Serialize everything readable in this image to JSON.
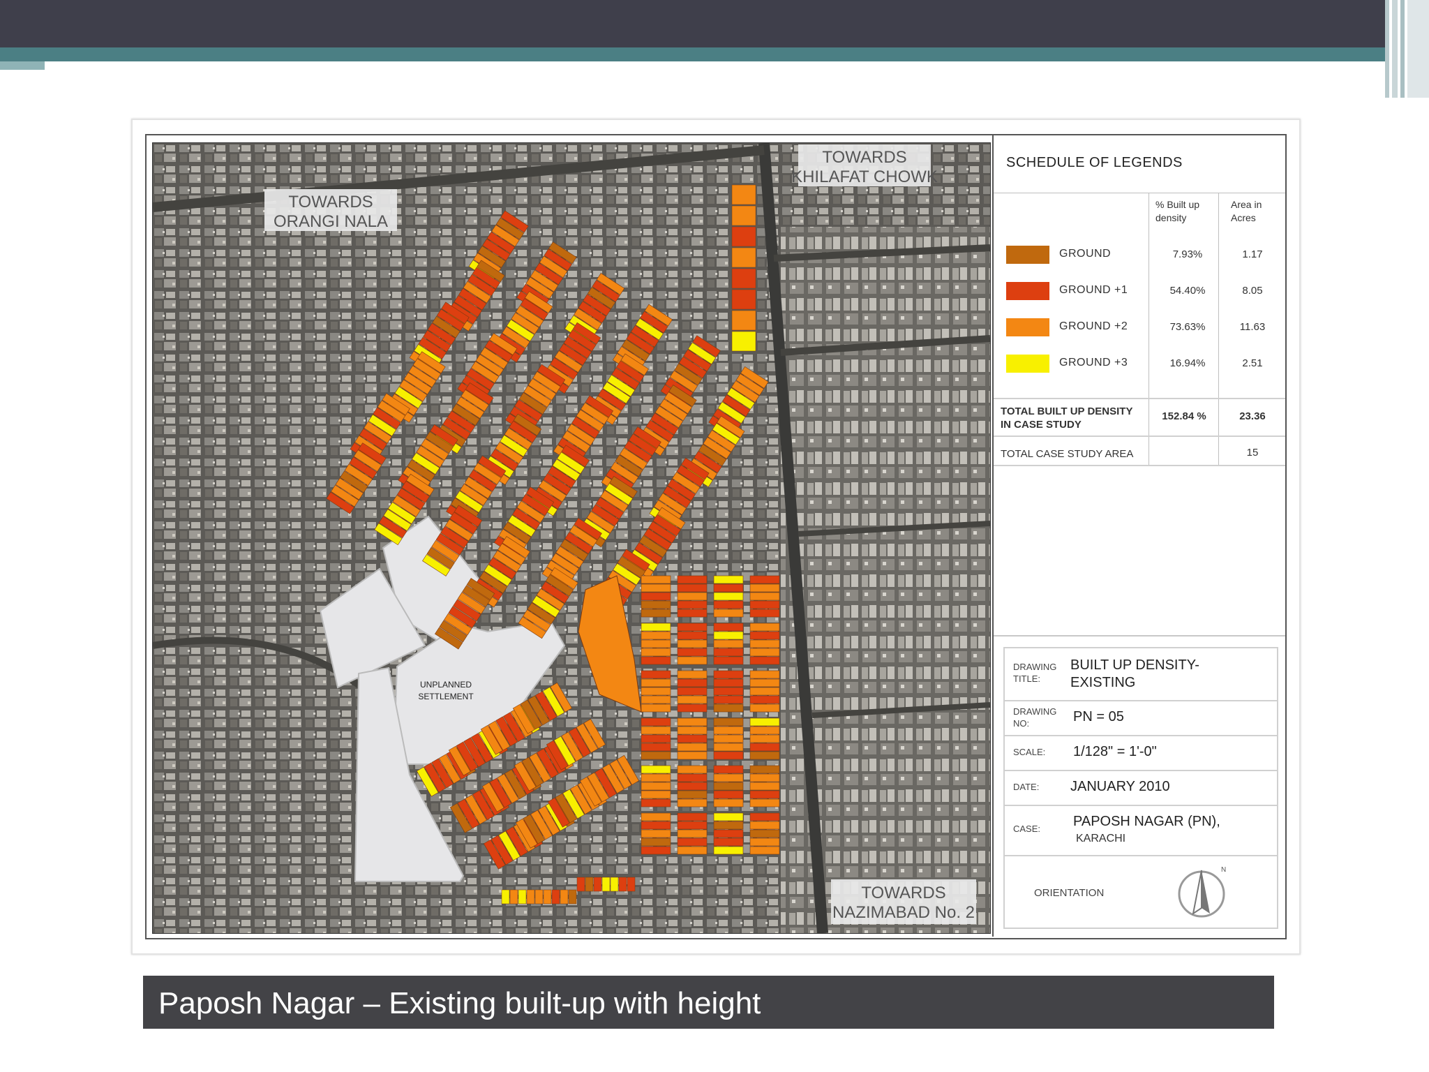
{
  "slide": {
    "caption": "Paposh Nagar – Existing built-up with height"
  },
  "map": {
    "labels": {
      "orangi_line1": "TOWARDS",
      "orangi_line2": "ORANGI NALA",
      "khilafat_line1": "TOWARDS",
      "khilafat_line2": "KHILAFAT CHOWK",
      "nazimabad_line1": "TOWARDS",
      "nazimabad_line2": "NAZIMABAD No. 2",
      "unplanned_line1": "UNPLANNED",
      "unplanned_line2": "SETTLEMENT"
    },
    "colors": {
      "ground": "#c0690e",
      "ground_plus_1": "#dd3f10",
      "ground_plus_2": "#f38713",
      "ground_plus_3": "#f8f000",
      "unplanned": "#e6e6e8",
      "road": "#3a3a38"
    }
  },
  "legend": {
    "title": "SCHEDULE OF LEGENDS",
    "col_density_line1": "% Built up",
    "col_density_line2": "density",
    "col_area_line1": "Area in",
    "col_area_line2": "Acres",
    "rows": [
      {
        "label": "GROUND",
        "density": "7.93%",
        "area": "1.17",
        "color": "#c0690e"
      },
      {
        "label": "GROUND  +1",
        "density": "54.40%",
        "area": "8.05",
        "color": "#dd3f10"
      },
      {
        "label": "GROUND  +2",
        "density": "73.63%",
        "area": "11.63",
        "color": "#f38713"
      },
      {
        "label": "GROUND  +3",
        "density": "16.94%",
        "area": "2.51",
        "color": "#f8f000"
      }
    ],
    "total_label_line1": "TOTAL BUILT UP DENSITY",
    "total_label_line2": "IN CASE STUDY",
    "total_density": "152.84 %",
    "total_area": "23.36",
    "case_area_label": "TOTAL CASE STUDY AREA",
    "case_area_value": "15"
  },
  "title_block": {
    "title_key_line1": "DRAWING",
    "title_key_line2": "TITLE:",
    "title_line1": "BUILT UP DENSITY-",
    "title_line2": "EXISTING",
    "no_key_line1": "DRAWING",
    "no_key_line2": "NO:",
    "drawing_no": "PN = 05",
    "scale_key": "SCALE:",
    "scale": "1/128\" = 1'-0\"",
    "date_key": "DATE:",
    "date": "JANUARY 2010",
    "case_key": "CASE:",
    "case_line1": "PAPOSH NAGAR (PN),",
    "case_line2": "KARACHI",
    "orientation": "ORIENTATION",
    "north": "N"
  }
}
